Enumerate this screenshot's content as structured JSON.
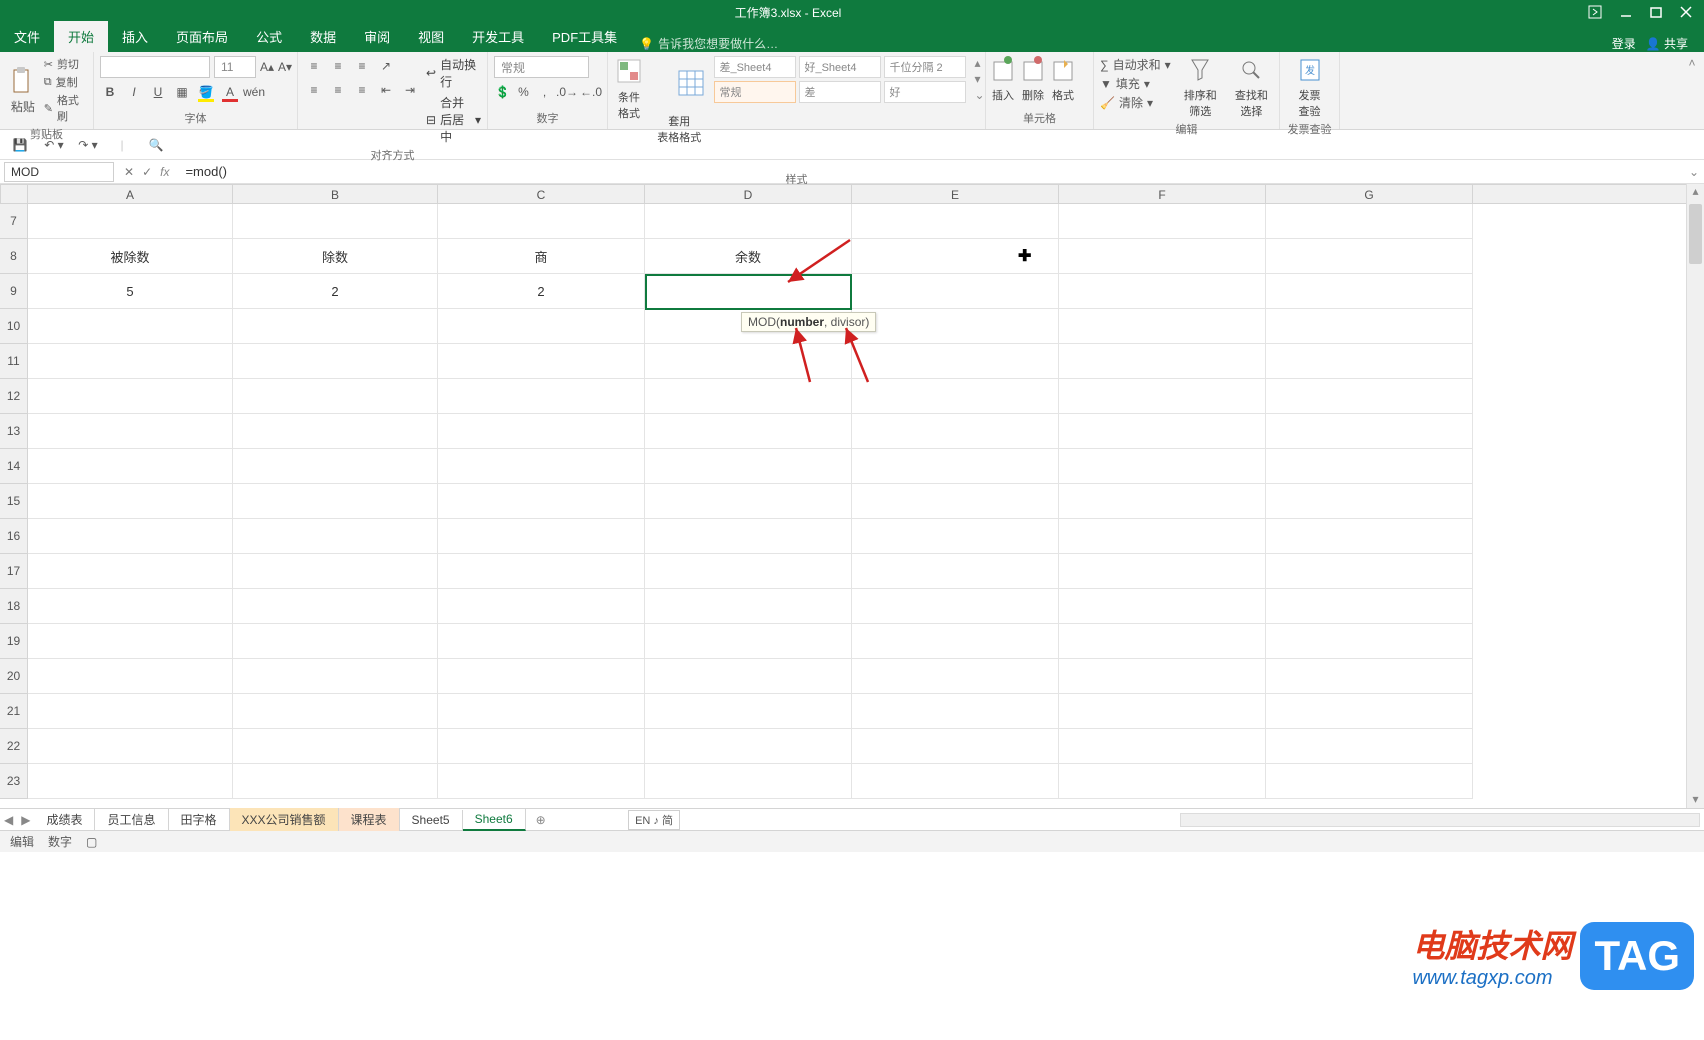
{
  "titlebar": {
    "title": "工作簿3.xlsx - Excel"
  },
  "menu": {
    "file": "文件",
    "tabs": [
      "开始",
      "插入",
      "页面布局",
      "公式",
      "数据",
      "审阅",
      "视图",
      "开发工具",
      "PDF工具集"
    ],
    "active_index": 0,
    "tell_me": "告诉我您想要做什么…",
    "login": "登录",
    "share": "共享"
  },
  "ribbon": {
    "clipboard": {
      "paste": "粘贴",
      "cut": "剪切",
      "copy": "复制",
      "format_painter": "格式刷",
      "label": "剪贴板"
    },
    "font": {
      "name": "",
      "size": "11",
      "label": "字体"
    },
    "alignment": {
      "wrap": "自动换行",
      "merge": "合并后居中",
      "label": "对齐方式"
    },
    "number": {
      "format": "常规",
      "label": "数字"
    },
    "styles": {
      "cond": "条件格式",
      "table": "套用\n表格格式",
      "items": [
        "差_Sheet4",
        "好_Sheet4",
        "千位分隔 2",
        "常规",
        "差",
        "好"
      ],
      "label": "样式"
    },
    "cells": {
      "insert": "插入",
      "delete": "删除",
      "format": "格式",
      "label": "单元格"
    },
    "editing": {
      "autosum": "自动求和",
      "fill": "填充",
      "clear": "清除",
      "sort": "排序和筛选",
      "find": "查找和选择",
      "label": "编辑"
    },
    "invoice": {
      "btn": "发票\n查验",
      "label": "发票查验"
    }
  },
  "formula_bar": {
    "name_box": "MOD",
    "formula": "=mod()"
  },
  "grid": {
    "columns": [
      "A",
      "B",
      "C",
      "D",
      "E",
      "F",
      "G"
    ],
    "row_start": 7,
    "row_end": 23,
    "data": {
      "8": {
        "A": "被除数",
        "B": "除数",
        "C": "商",
        "D": "余数"
      },
      "9": {
        "A": "5",
        "B": "2",
        "C": "2",
        "D": "=mod()"
      }
    },
    "active_cell": "D9",
    "tooltip": {
      "func": "MOD(",
      "arg1": "number",
      "rest": ", divisor)"
    }
  },
  "sheets": {
    "tabs": [
      "成绩表",
      "员工信息",
      "田字格",
      "XXX公司销售额",
      "课程表",
      "Sheet5",
      "Sheet6"
    ],
    "active_index": 6,
    "lang": "EN ♪ 简"
  },
  "status": {
    "mode": "编辑",
    "extra": "数字"
  },
  "watermark": {
    "line1": "电脑技术网",
    "line2": "www.tagxp.com",
    "tag": "TAG"
  }
}
